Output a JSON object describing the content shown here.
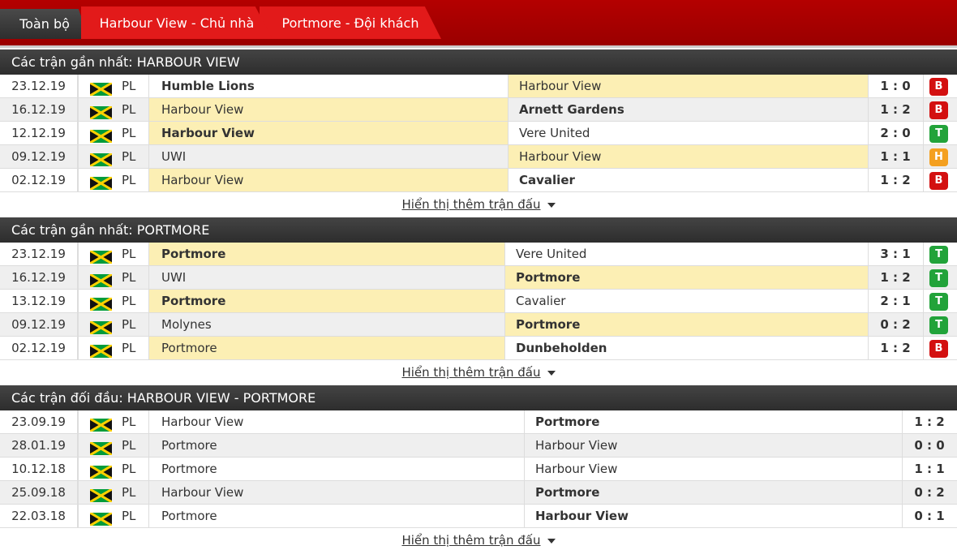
{
  "tabs": [
    "Toàn bộ",
    "Harbour View - Chủ nhà",
    "Portmore - Đội khách"
  ],
  "show_more": "Hiển thị thêm trận đấu",
  "colors": {
    "loss": "#d31010",
    "win": "#22a33a",
    "draw": "#f4a020",
    "highlight": "#fcefb4"
  },
  "sections": [
    {
      "title": "Các trận gần nhất: HARBOUR VIEW",
      "rows": [
        {
          "date": "23.12.19",
          "league": "PL",
          "home": "Humble Lions",
          "away": "Harbour View",
          "score": "1 : 0",
          "result": "B",
          "hl": "away",
          "bold": "home"
        },
        {
          "date": "16.12.19",
          "league": "PL",
          "home": "Harbour View",
          "away": "Arnett Gardens",
          "score": "1 : 2",
          "result": "B",
          "hl": "home",
          "bold": "away"
        },
        {
          "date": "12.12.19",
          "league": "PL",
          "home": "Harbour View",
          "away": "Vere United",
          "score": "2 : 0",
          "result": "T",
          "hl": "home",
          "bold": "home"
        },
        {
          "date": "09.12.19",
          "league": "PL",
          "home": "UWI",
          "away": "Harbour View",
          "score": "1 : 1",
          "result": "H",
          "hl": "away",
          "bold": ""
        },
        {
          "date": "02.12.19",
          "league": "PL",
          "home": "Harbour View",
          "away": "Cavalier",
          "score": "1 : 2",
          "result": "B",
          "hl": "home",
          "bold": "away"
        }
      ]
    },
    {
      "title": "Các trận gần nhất: PORTMORE",
      "rows": [
        {
          "date": "23.12.19",
          "league": "PL",
          "home": "Portmore",
          "away": "Vere United",
          "score": "3 : 1",
          "result": "T",
          "hl": "home",
          "bold": "home"
        },
        {
          "date": "16.12.19",
          "league": "PL",
          "home": "UWI",
          "away": "Portmore",
          "score": "1 : 2",
          "result": "T",
          "hl": "away",
          "bold": "away"
        },
        {
          "date": "13.12.19",
          "league": "PL",
          "home": "Portmore",
          "away": "Cavalier",
          "score": "2 : 1",
          "result": "T",
          "hl": "home",
          "bold": "home"
        },
        {
          "date": "09.12.19",
          "league": "PL",
          "home": "Molynes",
          "away": "Portmore",
          "score": "0 : 2",
          "result": "T",
          "hl": "away",
          "bold": "away"
        },
        {
          "date": "02.12.19",
          "league": "PL",
          "home": "Portmore",
          "away": "Dunbeholden",
          "score": "1 : 2",
          "result": "B",
          "hl": "home",
          "bold": "away"
        }
      ]
    },
    {
      "title": "Các trận đối đầu: HARBOUR VIEW - PORTMORE",
      "rows": [
        {
          "date": "23.09.19",
          "league": "PL",
          "home": "Harbour View",
          "away": "Portmore",
          "score": "1 : 2",
          "result": "",
          "hl": "",
          "bold": "away"
        },
        {
          "date": "28.01.19",
          "league": "PL",
          "home": "Portmore",
          "away": "Harbour View",
          "score": "0 : 0",
          "result": "",
          "hl": "",
          "bold": ""
        },
        {
          "date": "10.12.18",
          "league": "PL",
          "home": "Portmore",
          "away": "Harbour View",
          "score": "1 : 1",
          "result": "",
          "hl": "",
          "bold": ""
        },
        {
          "date": "25.09.18",
          "league": "PL",
          "home": "Harbour View",
          "away": "Portmore",
          "score": "0 : 2",
          "result": "",
          "hl": "",
          "bold": "away"
        },
        {
          "date": "22.03.18",
          "league": "PL",
          "home": "Portmore",
          "away": "Harbour View",
          "score": "0 : 1",
          "result": "",
          "hl": "",
          "bold": "away"
        }
      ]
    }
  ]
}
